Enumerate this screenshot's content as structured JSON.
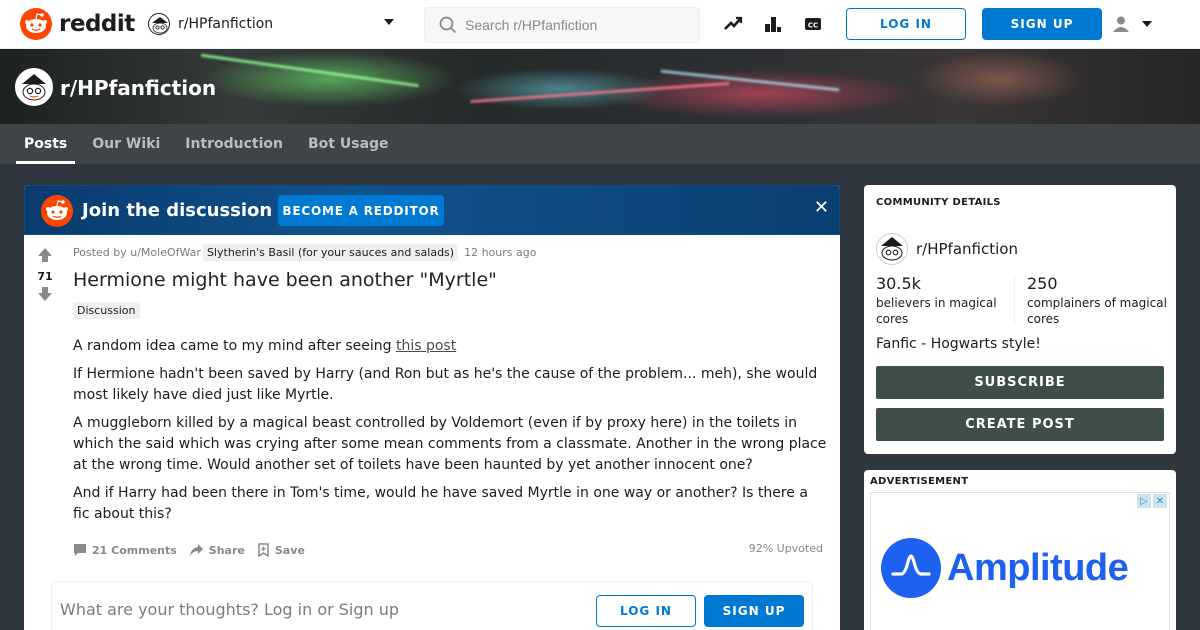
{
  "header": {
    "wordmark": "reddit",
    "community": "r/HPfanfiction",
    "search_placeholder": "Search r/HPfanfiction",
    "login_label": "LOG IN",
    "signup_label": "SIGN UP"
  },
  "banner": {
    "title": "r/HPfanfiction"
  },
  "tabs": [
    {
      "label": "Posts",
      "active": true
    },
    {
      "label": "Our Wiki",
      "active": false
    },
    {
      "label": "Introduction",
      "active": false
    },
    {
      "label": "Bot Usage",
      "active": false
    }
  ],
  "join": {
    "text": "Join the discussion",
    "button": "BECOME A REDDITOR",
    "close": "✕"
  },
  "post": {
    "score": "71",
    "posted_by": "Posted by u/MoleOfWar",
    "user_flair": "Slytherin's Basil (for your sauces and salads)",
    "time": "12 hours ago",
    "title": "Hermione might have been another \"Myrtle\"",
    "flair": "Discussion",
    "body": {
      "p1_text": "A random idea came to my mind after seeing ",
      "p1_link": "this post",
      "p2": "If Hermione hadn't been saved by Harry (and Ron but as he's the cause of the problem... meh), she would most likely have died just like Myrtle.",
      "p3": "A muggleborn killed by a magical beast controlled by Voldemort (even if by proxy here) in the toilets in which the said which was crying after some mean comments from a classmate. Another in the wrong place at the wrong time. Would another set of toilets have been haunted by yet another innocent one?",
      "p4": "And if Harry had been there in Tom's time, would he have saved Myrtle in one way or another? Is there a fic about this?"
    },
    "comments": "21 Comments",
    "share": "Share",
    "save": "Save",
    "upvoted": "92% Upvoted"
  },
  "comment_box": {
    "prompt": "What are your thoughts? Log in or Sign up",
    "login_label": "LOG IN",
    "signup_label": "SIGN UP"
  },
  "community": {
    "heading": "COMMUNITY DETAILS",
    "name": "r/HPfanfiction",
    "members": "30.5k",
    "members_label": "believers in magical cores",
    "online": "250",
    "online_label": "complainers of magical cores",
    "description": "Fanfic - Hogwarts style!",
    "subscribe": "SUBSCRIBE",
    "create_post": "CREATE POST"
  },
  "ad": {
    "label": "ADVERTISEMENT",
    "brand": "Amplitude"
  },
  "colors": {
    "reddit_orange": "#ff4500",
    "blue": "#0079d3",
    "theme_button": "#3e4f4a",
    "nav_bg": "#3e4447"
  }
}
